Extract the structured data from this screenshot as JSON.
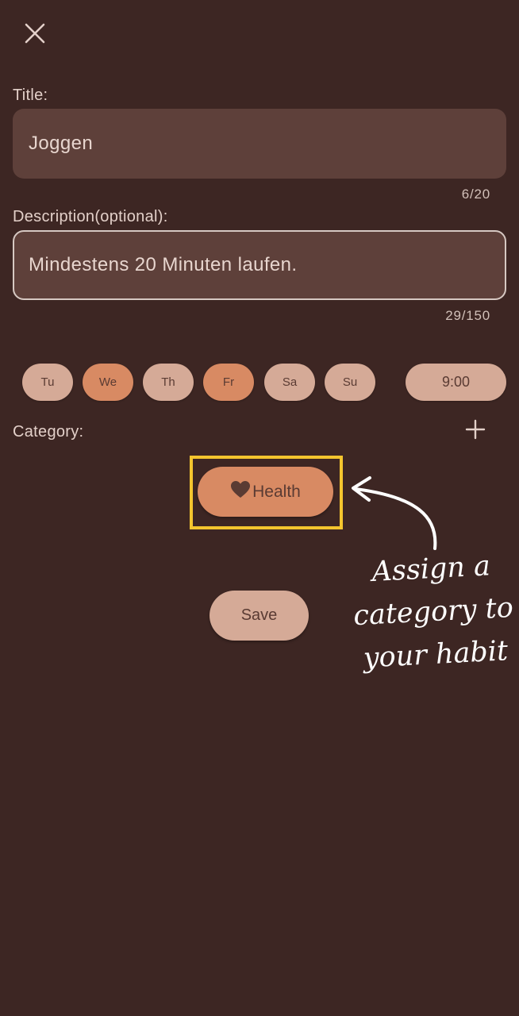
{
  "form": {
    "title_label": "Title:",
    "title_value": "Joggen",
    "title_counter": "6/20",
    "description_label": "Description(optional):",
    "description_value": "Mindestens 20 Minuten laufen.",
    "description_counter": "29/150"
  },
  "days": [
    {
      "label": "Tu",
      "selected": false
    },
    {
      "label": "We",
      "selected": true
    },
    {
      "label": "Th",
      "selected": false
    },
    {
      "label": "Fr",
      "selected": true
    },
    {
      "label": "Sa",
      "selected": false
    },
    {
      "label": "Su",
      "selected": false
    }
  ],
  "time": "9:00",
  "category": {
    "label": "Category:",
    "selected": "Health",
    "icon": "heart-icon"
  },
  "save_label": "Save",
  "annotation": {
    "line1": "Assign a",
    "line2": "category to",
    "line3": "your habit"
  },
  "colors": {
    "background": "#3d2623",
    "field": "#5e403a",
    "chip": "#d5aa97",
    "chip_selected": "#d88a63",
    "highlight": "#f4c52e"
  }
}
